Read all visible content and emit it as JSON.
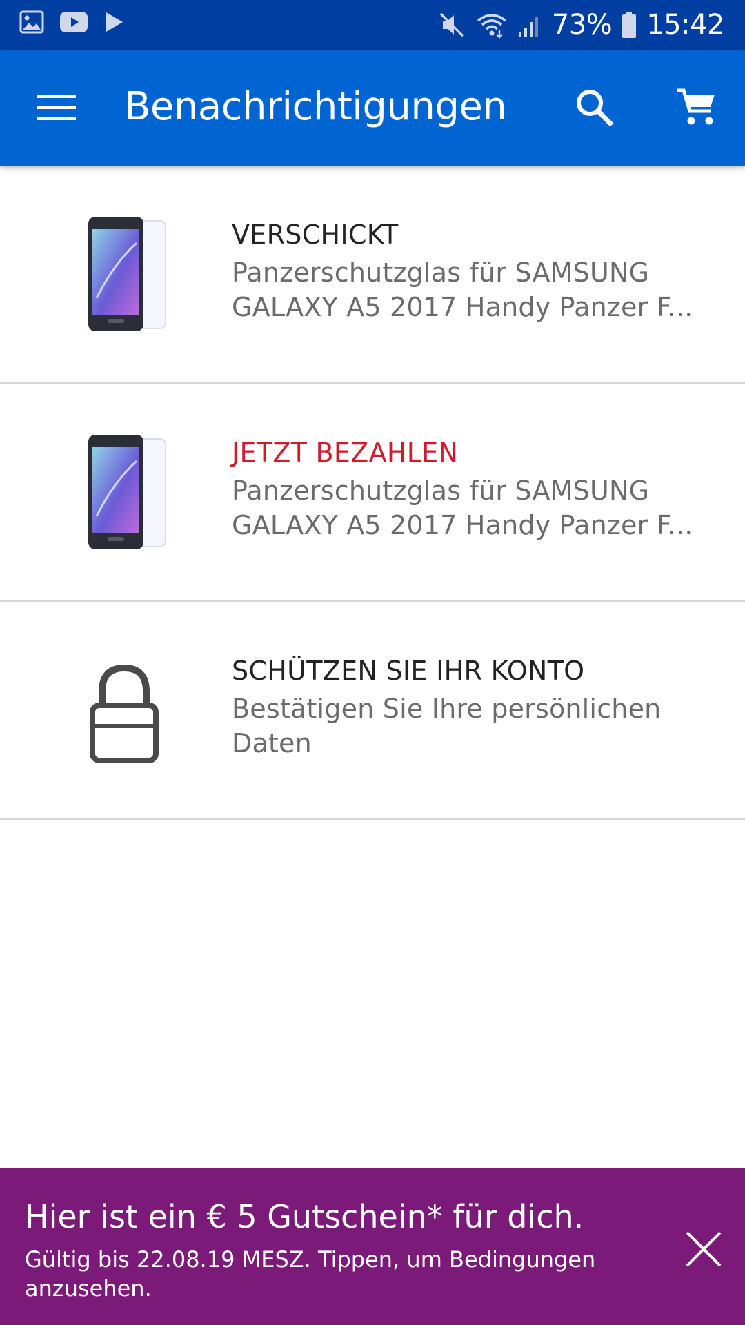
{
  "status_bar": {
    "battery": "73%",
    "time": "15:42",
    "icons": [
      "gallery-icon",
      "youtube-icon",
      "play-store-icon",
      "mute-icon",
      "wifi-icon",
      "signal-icon",
      "battery-icon"
    ]
  },
  "app_bar": {
    "title": "Benachrichtigungen",
    "background": "#0064d2",
    "icons": [
      "menu-icon",
      "search-icon",
      "cart-icon"
    ]
  },
  "notifications": [
    {
      "status": "VERSCHICKT",
      "status_color": "#222222",
      "description": "Panzerschutzglas für SAMSUNG GALAXY A5 2017 Handy Panzer F...",
      "icon": "product-thumbnail"
    },
    {
      "status": "JETZT BEZAHLEN",
      "status_color": "#d11a2a",
      "description": "Panzerschutzglas für SAMSUNG GALAXY A5 2017 Handy Panzer F...",
      "icon": "product-thumbnail"
    },
    {
      "status": "SCHÜTZEN SIE IHR KONTO",
      "status_color": "#222222",
      "description": "Bestätigen Sie Ihre persönlichen Daten",
      "icon": "lock-icon"
    }
  ],
  "banner": {
    "title": "Hier ist ein € 5 Gutschein* für dich.",
    "subtitle": "Gültig bis 22.08.19 MESZ. Tippen, um Bedingungen anzusehen.",
    "background": "#7b1a78"
  }
}
